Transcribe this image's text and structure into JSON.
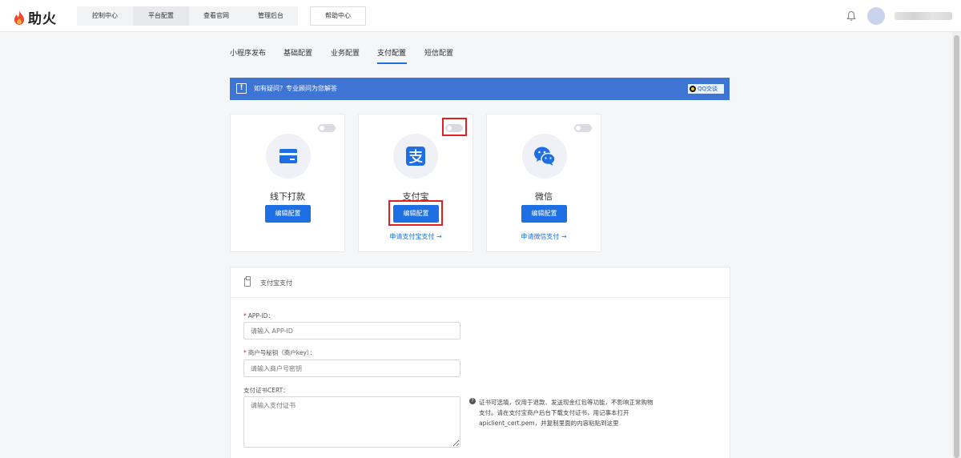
{
  "header": {
    "brand": "助火",
    "nav_tabs": [
      {
        "label": "控制中心",
        "active": false
      },
      {
        "label": "平台配置",
        "active": true
      },
      {
        "label": "查看官网",
        "active": false
      },
      {
        "label": "管理后台",
        "active": false
      }
    ],
    "help_label": "帮助中心",
    "bell_icon": "bell-icon"
  },
  "subtabs": [
    {
      "label": "小程序发布"
    },
    {
      "label": "基础配置"
    },
    {
      "label": "业务配置"
    },
    {
      "label": "支付配置",
      "active": true
    },
    {
      "label": "短信配置"
    }
  ],
  "banner": {
    "text": "如有疑问？专业顾问为您解答",
    "qq_label": "QQ交谈",
    "bg": "#3e74d4"
  },
  "cards": [
    {
      "title": "线下打款",
      "button": "编辑配置",
      "link": "",
      "icon": "bank-card-icon",
      "enabled": false
    },
    {
      "title": "支付宝",
      "button": "编辑配置",
      "link": "申请支付宝支付 →",
      "icon": "alipay-icon",
      "enabled": false
    },
    {
      "title": "微信",
      "button": "编辑配置",
      "link": "申请微信支付 →",
      "icon": "wechat-icon",
      "enabled": false
    }
  ],
  "form": {
    "title": "支付宝支付",
    "fields": [
      {
        "label": "APP-ID：",
        "required": true,
        "placeholder": "请输入 APP-ID"
      },
      {
        "label": "商户号秘钥（商户key）：",
        "required": true,
        "placeholder": "请输入商户号密钥"
      },
      {
        "label": "支付证书CERT：",
        "required": false,
        "placeholder": "请输入支付证书"
      }
    ],
    "hint": "证书可选填，仅用于退款、发送现金红包等功能，不影响正常购物支付。请在支付宝商户后台下载支付证书，用记事本打开apiclient_cert.pem，并复制里面的内容粘贴到这里"
  },
  "colors": {
    "accent": "#1f6fe4",
    "highlight": "#e02020"
  }
}
